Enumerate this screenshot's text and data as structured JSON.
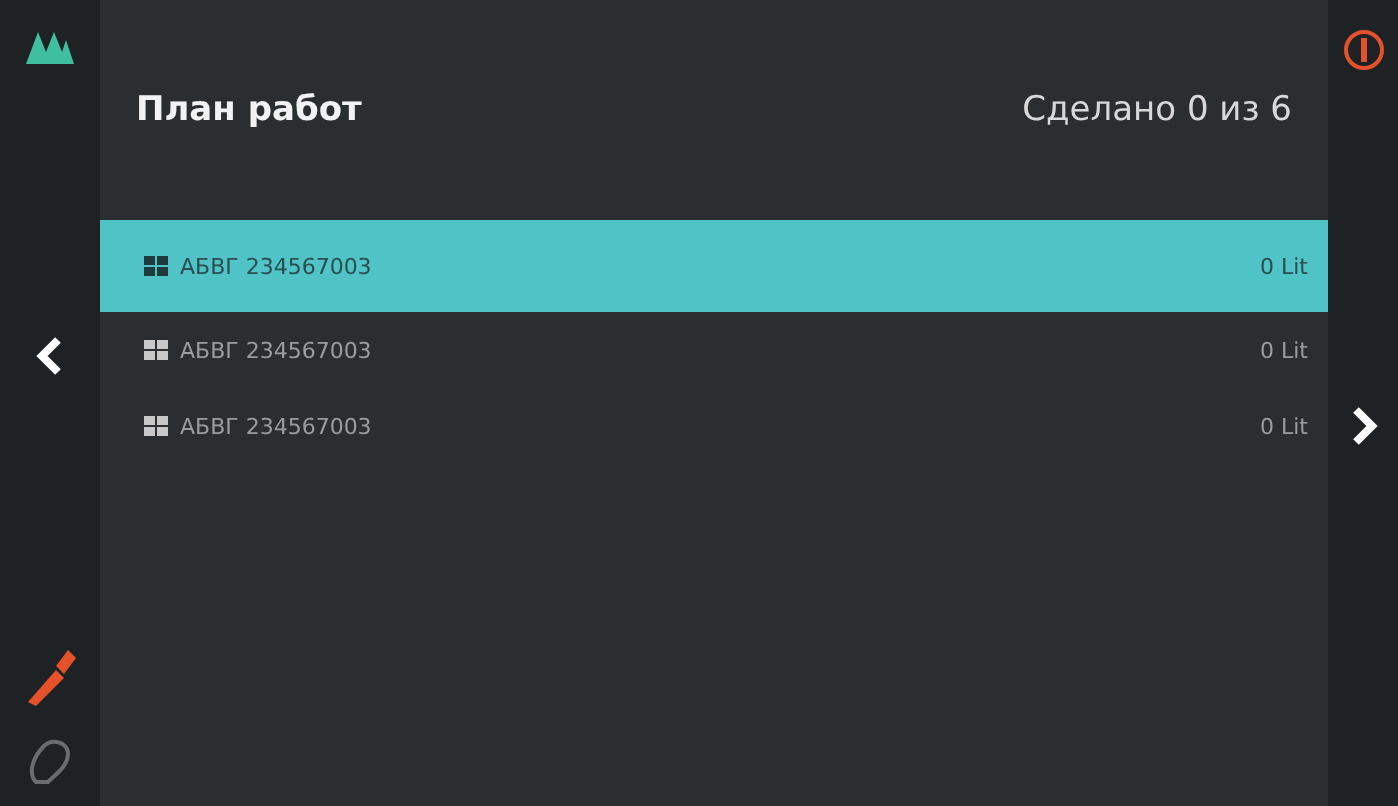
{
  "header": {
    "title": "План работ",
    "progress": "Сделано 0 из 6"
  },
  "rows": [
    {
      "code": "АБВГ 234567003",
      "amount": "0 Lit",
      "selected": true
    },
    {
      "code": "АБВГ 234567003",
      "amount": "0 Lit",
      "selected": false
    },
    {
      "code": "АБВГ 234567003",
      "amount": "0 Lit",
      "selected": false
    }
  ]
}
